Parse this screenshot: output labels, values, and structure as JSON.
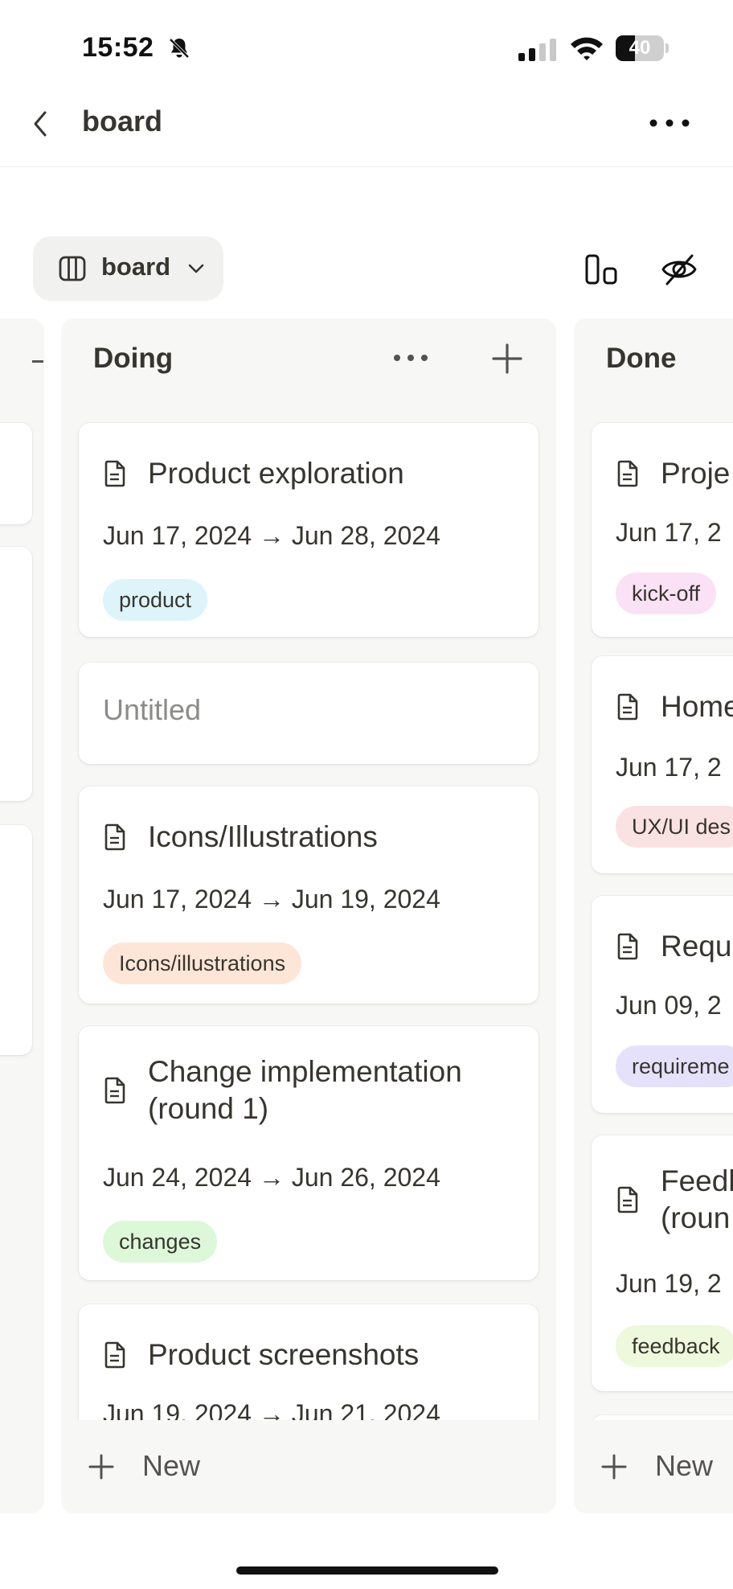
{
  "status_bar": {
    "time": "15:52",
    "battery": "40",
    "battery_level": 0.4
  },
  "nav": {
    "title": "board"
  },
  "toolbar": {
    "view_label": "board"
  },
  "columns": {
    "doing": {
      "title": "Doing",
      "new_label": "New",
      "cards": [
        {
          "title": "Product exploration",
          "date": "Jun 17, 2024 → Jun 28, 2024",
          "tag": "product",
          "tag_color": "#ddf4fb"
        },
        {
          "title": "Untitled"
        },
        {
          "title": "Icons/Illustrations",
          "date": "Jun 17, 2024 → Jun 19, 2024",
          "tag": "Icons/illustrations",
          "tag_color": "#fde6d8"
        },
        {
          "title": "Change implementation (round 1)",
          "date": "Jun 24, 2024 → Jun 26, 2024",
          "tag": "changes",
          "tag_color": "#dcf8d8"
        },
        {
          "title": "Product screenshots",
          "date": "Jun 19, 2024 → Jun 21, 2024"
        }
      ]
    },
    "done": {
      "title": "Done",
      "new_label": "New",
      "cards": [
        {
          "title": "Proje",
          "date": "Jun 17, 2",
          "tag": "kick-off",
          "tag_color": "#fbe1f5"
        },
        {
          "title": "Home",
          "date": "Jun 17, 2",
          "tag": "UX/UI des",
          "tag_color": "#fbe2e2"
        },
        {
          "title": "Requ",
          "date": "Jun 09, 2",
          "tag": "requireme",
          "tag_color": "#e6e1fb"
        },
        {
          "title": "Feedl\n(roun",
          "date": "Jun 19, 2",
          "tag": "feedback",
          "tag_color": "#eef8dc"
        }
      ]
    }
  }
}
